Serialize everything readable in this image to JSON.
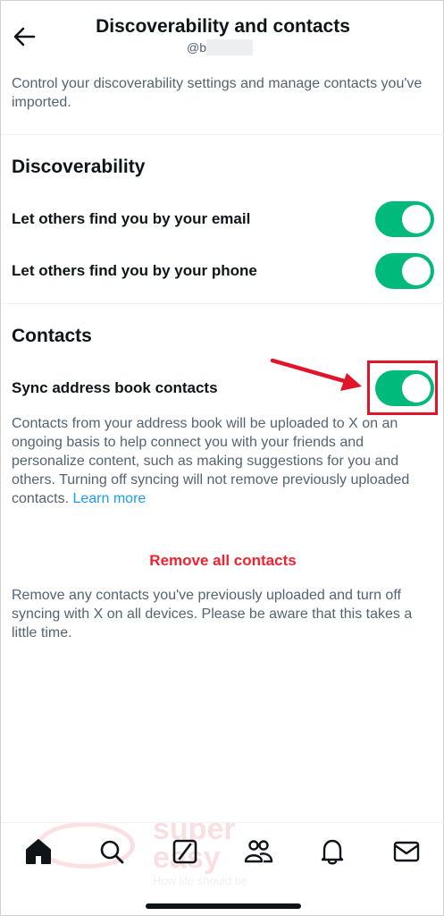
{
  "header": {
    "title": "Discoverability and contacts",
    "handle": "@b"
  },
  "intro_text": "Control your discoverability settings and manage contacts you've imported.",
  "discoverability": {
    "title": "Discoverability",
    "email_label": "Let others find you by your email",
    "email_on": true,
    "phone_label": "Let others find you by your phone",
    "phone_on": true
  },
  "contacts": {
    "title": "Contacts",
    "sync_label": "Sync address book contacts",
    "sync_on": true,
    "sync_description": "Contacts from your address book will be uploaded to X on an ongoing basis to help connect you with your friends and personalize content, such as making suggestions for you and others. Turning off syncing will not remove previously uploaded contacts.",
    "learn_more": "Learn more",
    "remove_label": "Remove all contacts",
    "remove_description": "Remove any contacts you've previously uploaded and turn off syncing with X on all devices. Please be aware that this takes a little time."
  },
  "watermark": {
    "brand_top": "super",
    "brand_bottom": "easy",
    "tagline": "How life should be"
  },
  "tabbar": {
    "icons": [
      "home-icon",
      "search-icon",
      "grok-icon",
      "communities-icon",
      "notifications-icon",
      "messages-icon"
    ]
  },
  "colors": {
    "toggle_on": "#00ba7c",
    "link": "#1d9bf0",
    "destructive": "#f4212e",
    "annotation": "#e0142a"
  }
}
